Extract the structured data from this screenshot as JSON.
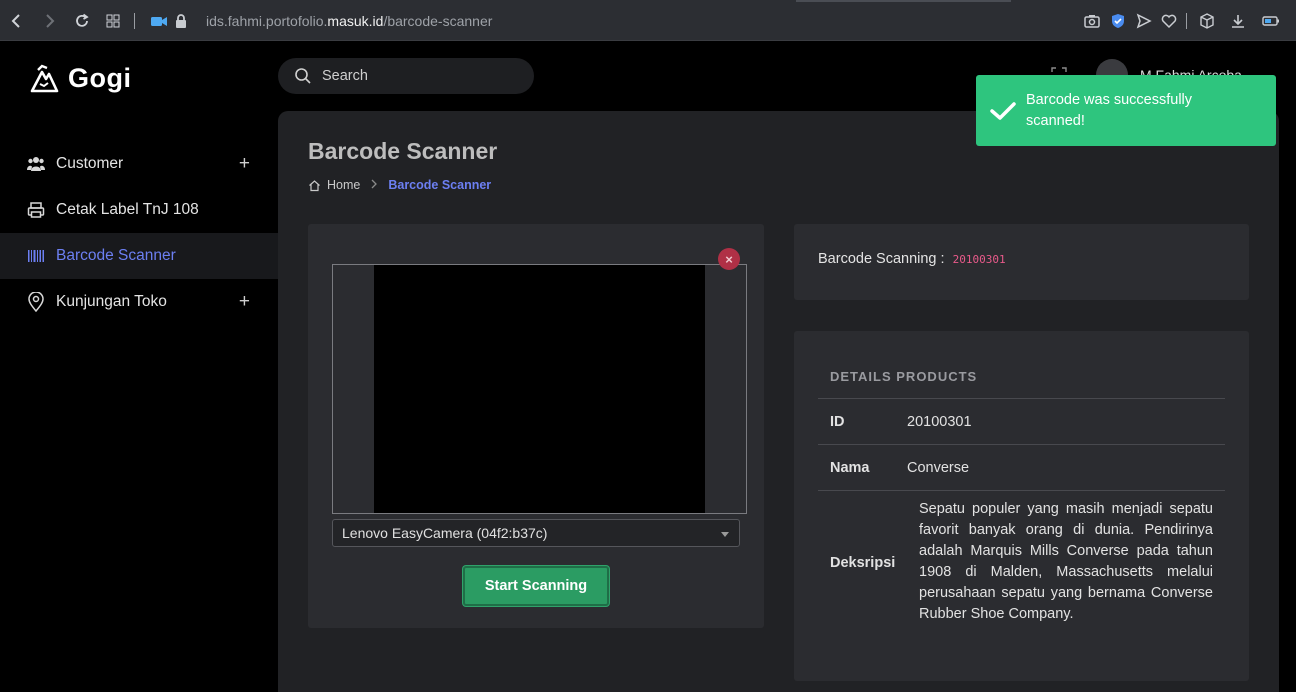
{
  "browser": {
    "url_prefix": "ids.fahmi.portofolio.",
    "url_host": "masuk.id",
    "url_path": "/barcode-scanner"
  },
  "brand": {
    "name": "Gogi"
  },
  "sidebar": {
    "items": [
      {
        "label": "Customer",
        "icon": "users-icon",
        "expandable": true
      },
      {
        "label": "Cetak Label TnJ 108",
        "icon": "printer-icon",
        "expandable": false
      },
      {
        "label": "Barcode Scanner",
        "icon": "barcode-icon",
        "expandable": false,
        "active": true
      },
      {
        "label": "Kunjungan Toko",
        "icon": "map-pin-icon",
        "expandable": true
      }
    ]
  },
  "header": {
    "search_placeholder": "Search",
    "user_name": "M Fahmi Arcoba"
  },
  "page": {
    "title": "Barcode Scanner",
    "breadcrumb": {
      "home": "Home",
      "current": "Barcode Scanner"
    }
  },
  "scanner": {
    "camera_selected": "Lenovo EasyCamera (04f2:b37c)",
    "start_label": "Start Scanning"
  },
  "result": {
    "label": "Barcode Scanning :",
    "code": "20100301"
  },
  "details": {
    "title": "DETAILS PRODUCTS",
    "rows": [
      {
        "key": "ID",
        "value": "20100301"
      },
      {
        "key": "Nama",
        "value": "Converse"
      },
      {
        "key": "Deksripsi",
        "value": "Sepatu populer yang masih menjadi sepatu favorit banyak orang di dunia. Pendirinya adalah Marquis Mills Converse pada tahun 1908 di Malden, Massachusetts melalui perusahaan sepatu yang bernama Converse Rubber Shoe Company."
      }
    ]
  },
  "toast": {
    "message": "Barcode was successfully scanned!"
  },
  "colors": {
    "accent": "#6c7ff2",
    "success": "#2ec57e",
    "button": "#2b9c63",
    "code": "#e85a8a",
    "danger": "#b03046"
  }
}
